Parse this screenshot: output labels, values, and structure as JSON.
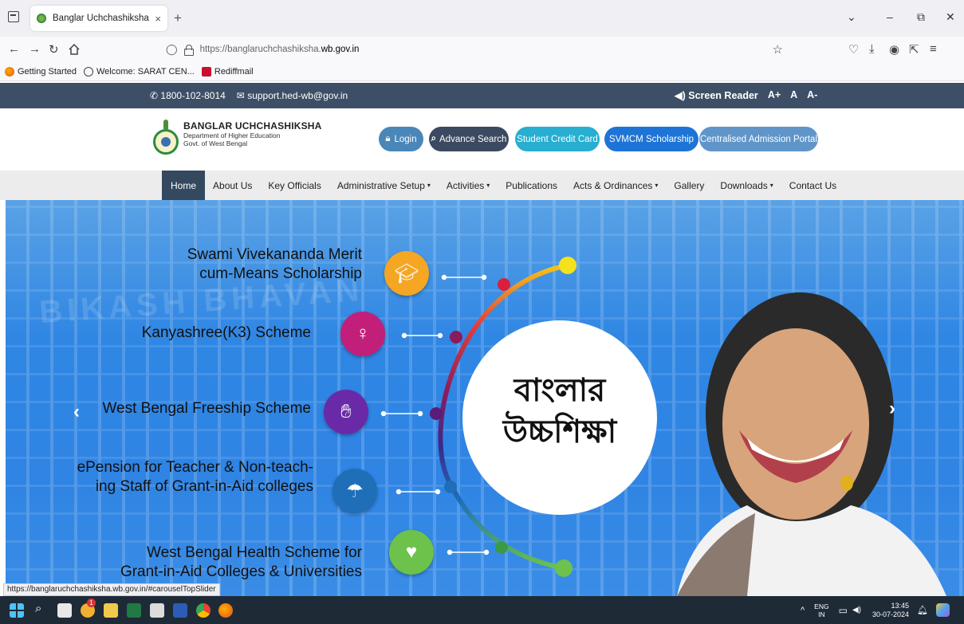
{
  "browser": {
    "tab_title": "Banglar Uchchashiksha",
    "tab_close": "×",
    "new_tab": "+",
    "url_prefix": "https://banglaruchchashiksha.",
    "url_host": "wb.gov.in",
    "window_minimize": "–",
    "window_restore": "⧉",
    "window_close": "✕",
    "tab_overflow": "⌄",
    "bookmarks": [
      "Getting Started",
      "Welcome: SARAT CEN...",
      "Rediffmail"
    ]
  },
  "site": {
    "phone": "1800-102-8014",
    "email": "support.hed-wb@gov.in",
    "screen_reader": "Screen Reader",
    "font_plus": "A+",
    "font_normal": "A",
    "font_minus": "A-",
    "brand_title": "BANGLAR UCHCHASHIKSHA",
    "brand_dept": "Department of Higher Education",
    "brand_govt": "Govt. of West Bengal",
    "buttons": {
      "login": "Login",
      "advance_search": "Advance Search",
      "student_credit_card": "Student Credit Card",
      "svmcm": "SVMCM Scholarship",
      "admission_portal": "Centralised Admission Portal"
    },
    "menu": [
      "Home",
      "About Us",
      "Key Officials",
      "Administrative Setup",
      "Activities",
      "Publications",
      "Acts & Ordinances",
      "Gallery",
      "Downloads",
      "Contact Us"
    ]
  },
  "hero": {
    "watermark": "BIKASH BHAVAN",
    "center_line1": "বাংলার",
    "center_line2": "উচ্চশিক্ষা",
    "schemes": [
      {
        "line1": "Swami Vivekananda Merit",
        "line2": "cum-Means Scholarship",
        "color": "#f5a623"
      },
      {
        "line1": "Kanyashree(K3) Scheme",
        "line2": "",
        "color": "#c21f7a"
      },
      {
        "line1": "West Bengal Freeship Scheme",
        "line2": "",
        "color": "#6a2aa8"
      },
      {
        "line1": "ePension for Teacher & Non-teach-",
        "line2": "ing Staff of Grant-in-Aid colleges",
        "color": "#1f6fb8"
      },
      {
        "line1": "West Bengal Health Scheme for",
        "line2": "Grant-in-Aid Colleges & Universities",
        "color": "#6cc24a"
      }
    ],
    "prev_arrow": "‹",
    "next_arrow": "›"
  },
  "status_url": "https://banglaruchchashiksha.wb.gov.in/#carouselTopSlider",
  "taskbar": {
    "lang": "ENG",
    "lang_region": "IN",
    "time": "13:45",
    "date": "30-07-2024",
    "notification_badge": "1"
  }
}
